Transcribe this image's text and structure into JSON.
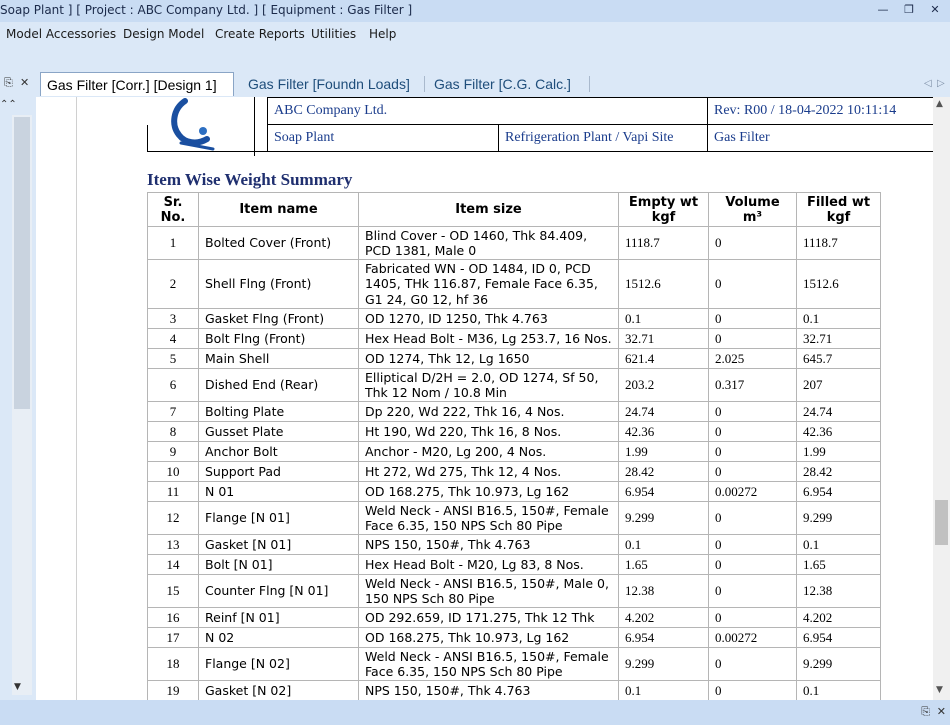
{
  "window": {
    "title": "Soap Plant ] [ Project : ABC Company Ltd. ] [ Equipment : Gas Filter ]"
  },
  "menu": {
    "items": [
      "Model Accessories",
      "Design Model",
      "Create Reports",
      "Utilities",
      "Help"
    ]
  },
  "tabs": [
    {
      "label": "Gas Filter [Corr.] [Design 1]"
    },
    {
      "label": "Gas Filter [Foundn Loads]"
    },
    {
      "label": "Gas Filter [C.G. Calc.]"
    }
  ],
  "header": {
    "row1": {
      "company": "ABC Company Ltd.",
      "revision": "Rev: R00 / 18-04-2022 10:11:14"
    },
    "row2": {
      "plant": "Soap Plant",
      "site": "Refrigeration Plant / Vapi Site",
      "equipment": "Gas Filter"
    }
  },
  "summary": {
    "title": "Item Wise Weight Summary",
    "columns": {
      "sr": "Sr. No.",
      "name": "Item name",
      "size": "Item size",
      "empty": "Empty wt kgf",
      "volume": "Volume m³",
      "filled": "Filled wt kgf"
    },
    "rows": [
      {
        "sr": "1",
        "name": "Bolted Cover (Front)",
        "size": "Blind Cover - OD 1460, Thk 84.409, PCD 1381, Male 0",
        "empty": "1118.7",
        "volume": "0",
        "filled": "1118.7"
      },
      {
        "sr": "2",
        "name": "Shell Flng (Front)",
        "size": "Fabricated WN - OD 1484, ID 0, PCD 1405, THk 116.87, Female Face 6.35, G1 24, G0 12, hf  36",
        "empty": "1512.6",
        "volume": "0",
        "filled": "1512.6"
      },
      {
        "sr": "3",
        "name": "Gasket Flng (Front)",
        "size": "OD 1270, ID 1250, Thk 4.763",
        "empty": "0.1",
        "volume": "0",
        "filled": "0.1"
      },
      {
        "sr": "4",
        "name": "Bolt Flng (Front)",
        "size": "Hex Head Bolt - M36, Lg 253.7, 16 Nos.",
        "empty": "32.71",
        "volume": "0",
        "filled": "32.71"
      },
      {
        "sr": "5",
        "name": "Main Shell",
        "size": "OD 1274, Thk 12, Lg 1650",
        "empty": "621.4",
        "volume": "2.025",
        "filled": "645.7"
      },
      {
        "sr": "6",
        "name": "Dished End (Rear)",
        "size": "Elliptical D/2H = 2.0, OD 1274, Sf 50, Thk 12 Nom / 10.8 Min",
        "empty": "203.2",
        "volume": "0.317",
        "filled": "207"
      },
      {
        "sr": "7",
        "name": "Bolting Plate",
        "size": "Dp 220, Wd 222, Thk 16, 4 Nos.",
        "empty": "24.74",
        "volume": "0",
        "filled": "24.74"
      },
      {
        "sr": "8",
        "name": "Gusset Plate",
        "size": "Ht 190, Wd 220, Thk 16, 8 Nos.",
        "empty": "42.36",
        "volume": "0",
        "filled": "42.36"
      },
      {
        "sr": "9",
        "name": "Anchor Bolt",
        "size": "Anchor - M20, Lg 200, 4 Nos.",
        "empty": "1.99",
        "volume": "0",
        "filled": "1.99"
      },
      {
        "sr": "10",
        "name": "Support Pad",
        "size": "Ht 272, Wd 275, Thk 12, 4 Nos.",
        "empty": "28.42",
        "volume": "0",
        "filled": "28.42"
      },
      {
        "sr": "11",
        "name": "N 01",
        "size": "OD 168.275, Thk 10.973, Lg 162",
        "empty": "6.954",
        "volume": "0.00272",
        "filled": "6.954"
      },
      {
        "sr": "12",
        "name": "Flange [N 01]",
        "size": "Weld Neck - ANSI B16.5, 150#, Female Face 6.35, 150 NPS Sch 80  Pipe",
        "empty": "9.299",
        "volume": "0",
        "filled": "9.299"
      },
      {
        "sr": "13",
        "name": "Gasket [N 01]",
        "size": "NPS 150, 150#, Thk 4.763",
        "empty": "0.1",
        "volume": "0",
        "filled": "0.1"
      },
      {
        "sr": "14",
        "name": "Bolt [N 01]",
        "size": "Hex Head Bolt - M20, Lg 83, 8 Nos.",
        "empty": "1.65",
        "volume": "0",
        "filled": "1.65"
      },
      {
        "sr": "15",
        "name": "Counter Flng [N 01]",
        "size": "Weld Neck - ANSI B16.5, 150#, Male 0, 150 NPS Sch 80  Pipe",
        "empty": "12.38",
        "volume": "0",
        "filled": "12.38"
      },
      {
        "sr": "16",
        "name": "Reinf [N 01]",
        "size": "OD 292.659, ID 171.275, Thk 12 Thk",
        "empty": "4.202",
        "volume": "0",
        "filled": "4.202"
      },
      {
        "sr": "17",
        "name": "N 02",
        "size": "OD 168.275, Thk 10.973, Lg 162",
        "empty": "6.954",
        "volume": "0.00272",
        "filled": "6.954"
      },
      {
        "sr": "18",
        "name": "Flange [N 02]",
        "size": "Weld Neck - ANSI B16.5, 150#, Female Face 6.35, 150 NPS Sch 80  Pipe",
        "empty": "9.299",
        "volume": "0",
        "filled": "9.299"
      },
      {
        "sr": "19",
        "name": "Gasket [N 02]",
        "size": "NPS 150, 150#, Thk 4.763",
        "empty": "0.1",
        "volume": "0",
        "filled": "0.1"
      }
    ]
  },
  "colors": {
    "accent": "#1f2f6f",
    "header_text": "#1a3c8c",
    "chrome": "#dbe8f7"
  },
  "icons": {
    "logo": "company-logo-icon",
    "pin": "pin-icon",
    "close": "close-icon"
  }
}
